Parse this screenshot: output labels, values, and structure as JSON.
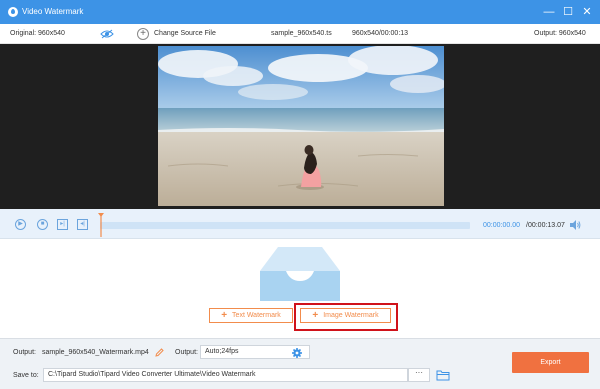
{
  "window": {
    "title": "Video Watermark",
    "minimize": "—",
    "maximize": "☐",
    "close": "✕"
  },
  "info": {
    "original": "Original: 960x540",
    "change_source": "Change Source File",
    "filename": "sample_960x540.ts",
    "meta": "960x540/00:00:13",
    "output": "Output: 960x540",
    "add_icon": "+"
  },
  "player": {
    "current_time": "00:00:00.00",
    "total_time": "/00:00:13.07",
    "progress": 0
  },
  "watermark": {
    "text_btn": "Text Watermark",
    "image_btn": "Image Watermark",
    "plus": "+"
  },
  "bottom": {
    "output_label": "Output:",
    "output_file": "sample_960x540_Watermark.mp4",
    "format_label": "Output:",
    "format_value": "Auto;24fps",
    "save_label": "Save to:",
    "save_path": "C:\\Tipard Studio\\Tipard Video Converter Ultimate\\Video Watermark",
    "browse": "···",
    "export": "Export"
  },
  "colors": {
    "titlebar": "#3d93e6",
    "accent": "#f28c4c",
    "export": "#f07140",
    "highlight": "#d0121a"
  }
}
